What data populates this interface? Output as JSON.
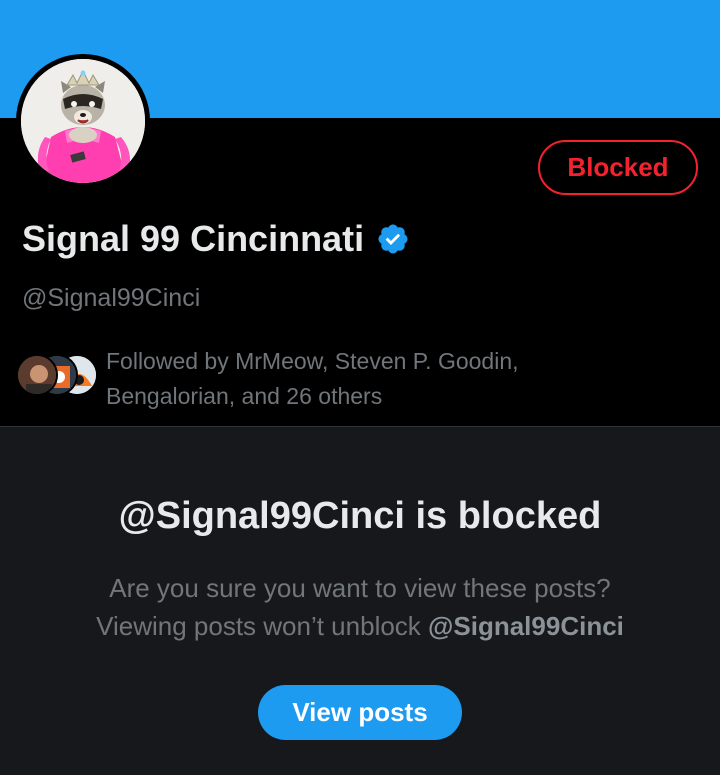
{
  "profile": {
    "display_name": "Signal 99 Cincinnati",
    "handle": "@Signal99Cinci",
    "blocked_label": "Blocked",
    "verified_icon": "verified-badge-icon",
    "followed_by_line1": "Followed by MrMeow, Steven P. Goodin,",
    "followed_by_line2": "Bengalorian, and 26 others"
  },
  "blocked_notice": {
    "title": "@Signal99Cinci is blocked",
    "line1": "Are you sure you want to view these posts?",
    "line2_prefix": "Viewing posts won’t unblock ",
    "line2_handle": "@Signal99Cinci",
    "view_button": "View posts"
  },
  "colors": {
    "banner": "#1d9bf0",
    "blocked_red": "#f4212e",
    "accent_blue": "#1d9bf0"
  }
}
